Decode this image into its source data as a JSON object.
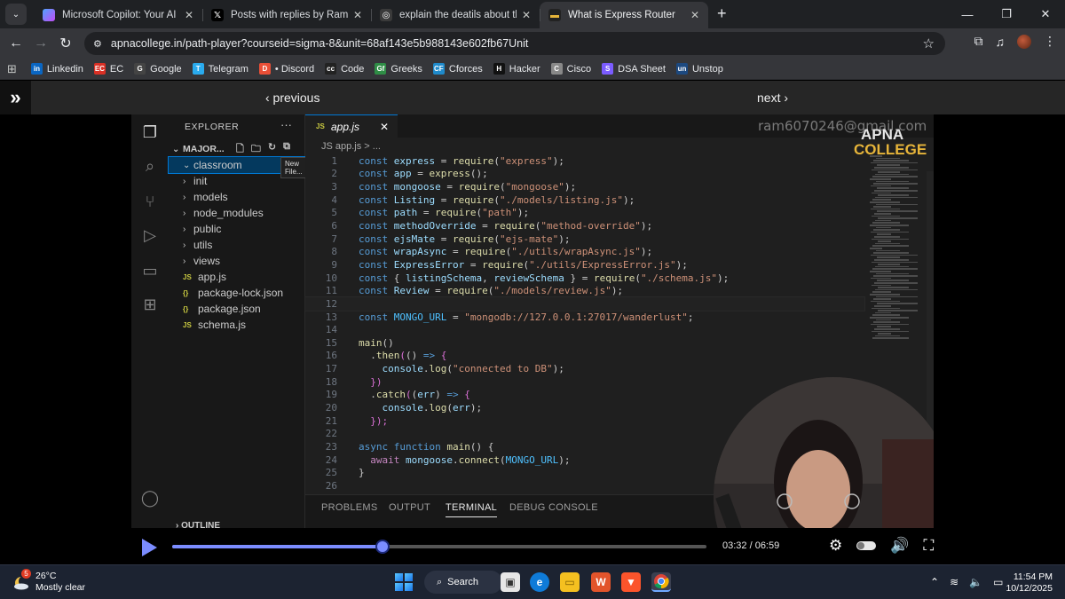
{
  "browser": {
    "tabs": [
      {
        "label": "Microsoft Copilot: Your AI comp",
        "icon": "copilot-icon",
        "active": false
      },
      {
        "label": "Posts with replies by Rambilas S",
        "icon": "x-icon",
        "active": false
      },
      {
        "label": "explain the deatils about the wi",
        "icon": "chatgpt-icon",
        "active": false
      },
      {
        "label": "What is Express Router",
        "icon": "apna-college-icon",
        "active": true
      }
    ],
    "url": "apnacollege.in/path-player?courseid=sigma-8&unit=68af143e5b988143e602fb67Unit",
    "bookmarks": [
      {
        "label": "Linkedin",
        "icon": "in",
        "color": "#0a66c2"
      },
      {
        "label": "EC",
        "icon": "EC",
        "color": "#d93025"
      },
      {
        "label": "Google",
        "icon": "G",
        "color": "#444"
      },
      {
        "label": "Telegram",
        "icon": "T",
        "color": "#2aabee"
      },
      {
        "label": "• Discord",
        "icon": "D",
        "color": "#e94f37"
      },
      {
        "label": "Code",
        "icon": "cc",
        "color": "#222"
      },
      {
        "label": "Greeks",
        "icon": "Gf",
        "color": "#2f8d46"
      },
      {
        "label": "Cforces",
        "icon": "CF",
        "color": "#1f8acb"
      },
      {
        "label": "Hacker",
        "icon": "H",
        "color": "#111"
      },
      {
        "label": "Cisco",
        "icon": "C",
        "color": "#888"
      },
      {
        "label": "DSA Sheet",
        "icon": "S",
        "color": "#7b5cff"
      },
      {
        "label": "Unstop",
        "icon": "un",
        "color": "#1c4980"
      }
    ]
  },
  "player": {
    "previous_label": "‹ previous",
    "next_label": "next ›",
    "time": "03:32 / 06:59",
    "progress_fraction": 0.394
  },
  "vscode": {
    "explorer_title": "EXPLORER",
    "project": "MAJOR...",
    "tooltip": "New File...",
    "tree": [
      {
        "label": "classroom",
        "type": "folder",
        "open": true,
        "selected": true
      },
      {
        "label": "init",
        "type": "folder"
      },
      {
        "label": "models",
        "type": "folder"
      },
      {
        "label": "node_modules",
        "type": "folder"
      },
      {
        "label": "public",
        "type": "folder"
      },
      {
        "label": "utils",
        "type": "folder"
      },
      {
        "label": "views",
        "type": "folder"
      },
      {
        "label": "app.js",
        "type": "js"
      },
      {
        "label": "package-lock.json",
        "type": "json"
      },
      {
        "label": "package.json",
        "type": "json"
      },
      {
        "label": "schema.js",
        "type": "js"
      }
    ],
    "outline": "OUTLINE",
    "tab": "app.js",
    "breadcrumb": "JS app.js > ...",
    "email": "ram6070246@gmail.com",
    "logo_top": "APNA",
    "logo_bottom": "COLLEGE",
    "panel_tabs": [
      "PROBLEMS",
      "OUTPUT",
      "TERMINAL",
      "DEBUG CONSOLE"
    ],
    "panel_active": "TERMINAL"
  },
  "taskbar": {
    "temp": "26°C",
    "weather": "Mostly clear",
    "badge": "5",
    "search": "Search",
    "time": "11:54 PM",
    "date": "10/12/2025"
  }
}
